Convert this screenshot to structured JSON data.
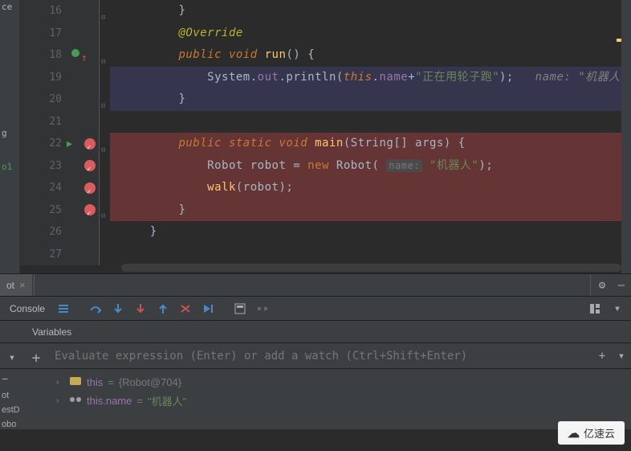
{
  "left_panel": {
    "items": [
      "ce",
      "g",
      "o1"
    ]
  },
  "code_lines": [
    {
      "num": 16,
      "indent": 2,
      "tokens": [
        {
          "t": "plain",
          "v": "}"
        }
      ],
      "fold": "up"
    },
    {
      "num": 17,
      "indent": 2,
      "tokens": [
        {
          "t": "ann",
          "v": "@Override"
        }
      ]
    },
    {
      "num": 18,
      "indent": 2,
      "tokens": [
        {
          "t": "kw",
          "v": "public"
        },
        {
          "t": "plain",
          "v": " "
        },
        {
          "t": "kw",
          "v": "void"
        },
        {
          "t": "plain",
          "v": " "
        },
        {
          "t": "method",
          "v": "run"
        },
        {
          "t": "plain",
          "v": "() {"
        }
      ],
      "marker": "arrow",
      "fold": "down"
    },
    {
      "num": 19,
      "indent": 3,
      "tokens": [
        {
          "t": "plain",
          "v": "System."
        },
        {
          "t": "field",
          "v": "out"
        },
        {
          "t": "plain",
          "v": ".println("
        },
        {
          "t": "kw",
          "v": "this"
        },
        {
          "t": "plain",
          "v": "."
        },
        {
          "t": "field",
          "v": "name"
        },
        {
          "t": "plain",
          "v": "+"
        },
        {
          "t": "str",
          "v": "\"正在用轮子跑\""
        },
        {
          "t": "plain",
          "v": ");   "
        },
        {
          "t": "comment",
          "v": "name: \"机器人"
        }
      ],
      "hl": "blue"
    },
    {
      "num": 20,
      "indent": 2,
      "tokens": [
        {
          "t": "plain",
          "v": "}"
        }
      ],
      "hl": "blue",
      "fold": "up"
    },
    {
      "num": 21,
      "indent": 0,
      "tokens": []
    },
    {
      "num": 22,
      "indent": 2,
      "tokens": [
        {
          "t": "kw",
          "v": "public"
        },
        {
          "t": "plain",
          "v": " "
        },
        {
          "t": "kw",
          "v": "static"
        },
        {
          "t": "plain",
          "v": " "
        },
        {
          "t": "kw",
          "v": "void"
        },
        {
          "t": "plain",
          "v": " "
        },
        {
          "t": "method",
          "v": "main"
        },
        {
          "t": "plain",
          "v": "(String[] "
        },
        {
          "t": "plain",
          "v": "args"
        },
        {
          "t": "plain",
          "v": ") {"
        }
      ],
      "hl": "red",
      "marker": "run-bp",
      "fold": "down"
    },
    {
      "num": 23,
      "indent": 3,
      "tokens": [
        {
          "t": "plain",
          "v": "Robot robot = "
        },
        {
          "t": "kw2",
          "v": "new"
        },
        {
          "t": "plain",
          "v": " Robot( "
        },
        {
          "t": "hint",
          "v": "name:"
        },
        {
          "t": "plain",
          "v": " "
        },
        {
          "t": "str",
          "v": "\"机器人\""
        },
        {
          "t": "plain",
          "v": ");"
        }
      ],
      "hl": "red",
      "marker": "bp"
    },
    {
      "num": 24,
      "indent": 3,
      "tokens": [
        {
          "t": "method",
          "v": "walk"
        },
        {
          "t": "plain",
          "v": "(robot);"
        }
      ],
      "hl": "red",
      "marker": "bp"
    },
    {
      "num": 25,
      "indent": 2,
      "tokens": [
        {
          "t": "plain",
          "v": "}"
        }
      ],
      "hl": "red",
      "marker": "bp",
      "fold": "up"
    },
    {
      "num": 26,
      "indent": 1,
      "tokens": [
        {
          "t": "plain",
          "v": "}"
        }
      ]
    },
    {
      "num": 27,
      "indent": 0,
      "tokens": []
    }
  ],
  "tab": {
    "name": "ot",
    "close": "×"
  },
  "tab_actions": {
    "gear": "⚙",
    "minimize": "—"
  },
  "toolbar": {
    "console_label": "Console",
    "icons": [
      "frames",
      "step-over",
      "step-into",
      "force-step-into",
      "step-out",
      "drop-frame",
      "run-to-cursor",
      "evaluate",
      "trace"
    ],
    "layout_icon": "layout"
  },
  "sub_tab": "Variables",
  "watch": {
    "placeholder": "Evaluate expression (Enter) or add a watch (Ctrl+Shift+Enter)"
  },
  "side_buttons": {
    "restart": "↻",
    "down": "▾",
    "plus": "+",
    "minus": "−",
    "up2": "▴",
    "down2": "▾"
  },
  "vars_side": [
    "ot",
    "estD",
    "obo"
  ],
  "variables": [
    {
      "name": "this",
      "op": " = ",
      "val": "{Robot@704}",
      "icon": "obj"
    },
    {
      "name": "this.name",
      "op": " = ",
      "val": "\"机器人\"",
      "icon": "field",
      "str": true
    }
  ],
  "watermark": "亿速云"
}
